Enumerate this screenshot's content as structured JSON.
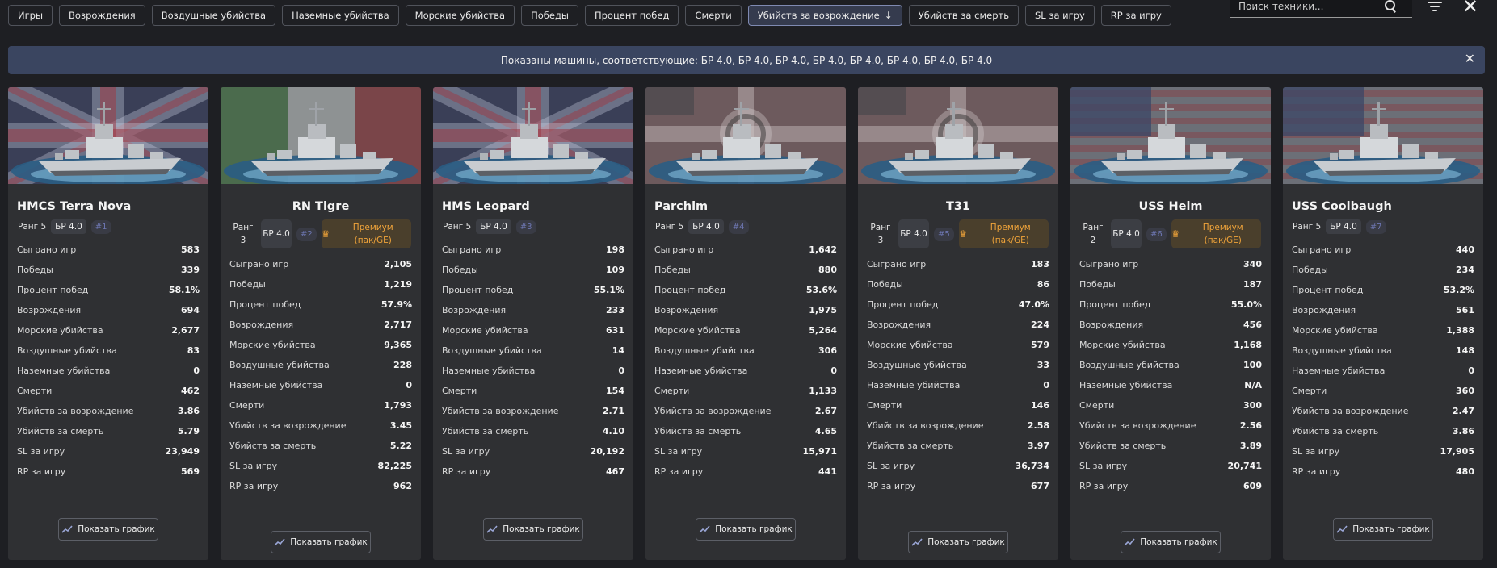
{
  "sort_buttons": [
    {
      "label": "Игры",
      "active": false
    },
    {
      "label": "Возрождения",
      "active": false
    },
    {
      "label": "Воздушные убийства",
      "active": false
    },
    {
      "label": "Наземные убийства",
      "active": false
    },
    {
      "label": "Морские убийства",
      "active": false
    },
    {
      "label": "Победы",
      "active": false
    },
    {
      "label": "Процент побед",
      "active": false
    },
    {
      "label": "Смерти",
      "active": false
    },
    {
      "label": "Убийств за возрождение",
      "active": true,
      "icon": "arrow-down-icon"
    },
    {
      "label": "Убийств за смерть",
      "active": false
    },
    {
      "label": "SL за игру",
      "active": false
    },
    {
      "label": "RP за игру",
      "active": false
    }
  ],
  "search": {
    "placeholder": "Поиск техники..."
  },
  "icons": {
    "search": "search-icon",
    "filter": "filter-icon",
    "close": "close-icon",
    "chart": "chart-line-icon",
    "premium": "crown-icon"
  },
  "banner": {
    "text": "Показаны машины, соответствующие: БР 4.0, БР 4.0, БР 4.0, БР 4.0, БР 4.0, БР 4.0, БР 4.0, БР 4.0"
  },
  "chart_button_label": "Показать график",
  "stat_labels": [
    "Сыграно игр",
    "Победы",
    "Процент побед",
    "Возрождения",
    "Морские убийства",
    "Воздушные убийства",
    "Наземные убийства",
    "Смерти",
    "Убийств за возрождение",
    "Убийств за смерть",
    "SL за игру",
    "RP за игру"
  ],
  "colors": {
    "background": "#1e1f23",
    "card": "#2f3033",
    "banner": "#3a4560",
    "premium_text": "#f0a43a",
    "rank_badge": "#6e77b3"
  },
  "vehicles": [
    {
      "name": "HMCS Terra Nova",
      "flag": "uk",
      "rank": "Ранг 5",
      "br": "БР 4.0",
      "position": "#1",
      "premium": null,
      "stats": [
        "583",
        "339",
        "58.1%",
        "694",
        "2,677",
        "83",
        "0",
        "462",
        "3.86",
        "5.79",
        "23,949",
        "569"
      ]
    },
    {
      "name": "RN Tigre",
      "flag": "italy",
      "rank": "Ранг 3",
      "br": "БР 4.0",
      "position": "#2",
      "premium": "Премиум (пак/GE)",
      "stats": [
        "2,105",
        "1,219",
        "57.9%",
        "2,717",
        "9,365",
        "228",
        "0",
        "1,793",
        "3.45",
        "5.22",
        "82,225",
        "962"
      ]
    },
    {
      "name": "HMS Leopard",
      "flag": "uk",
      "rank": "Ранг 5",
      "br": "БР 4.0",
      "position": "#3",
      "premium": null,
      "stats": [
        "198",
        "109",
        "55.1%",
        "233",
        "631",
        "14",
        "0",
        "154",
        "2.71",
        "4.10",
        "20,192",
        "467"
      ]
    },
    {
      "name": "Parchim",
      "flag": "germany",
      "rank": "Ранг 5",
      "br": "БР 4.0",
      "position": "#4",
      "premium": null,
      "stats": [
        "1,642",
        "880",
        "53.6%",
        "1,975",
        "5,264",
        "306",
        "0",
        "1,133",
        "2.67",
        "4.65",
        "15,971",
        "441"
      ]
    },
    {
      "name": "T31",
      "flag": "germany",
      "rank": "Ранг 3",
      "br": "БР 4.0",
      "position": "#5",
      "premium": "Премиум (пак/GE)",
      "stats": [
        "183",
        "86",
        "47.0%",
        "224",
        "579",
        "33",
        "0",
        "146",
        "2.58",
        "3.97",
        "36,734",
        "677"
      ]
    },
    {
      "name": "USS Helm",
      "flag": "usa",
      "rank": "Ранг 2",
      "br": "БР 4.0",
      "position": "#6",
      "premium": "Премиум (пак/GE)",
      "stats": [
        "340",
        "187",
        "55.0%",
        "456",
        "1,168",
        "100",
        "N/A",
        "300",
        "2.56",
        "3.89",
        "20,741",
        "609"
      ]
    },
    {
      "name": "USS Coolbaugh",
      "flag": "usa",
      "rank": "Ранг 5",
      "br": "БР 4.0",
      "position": "#7",
      "premium": null,
      "stats": [
        "440",
        "234",
        "53.2%",
        "561",
        "1,388",
        "148",
        "0",
        "360",
        "2.47",
        "3.86",
        "17,905",
        "480"
      ]
    }
  ]
}
